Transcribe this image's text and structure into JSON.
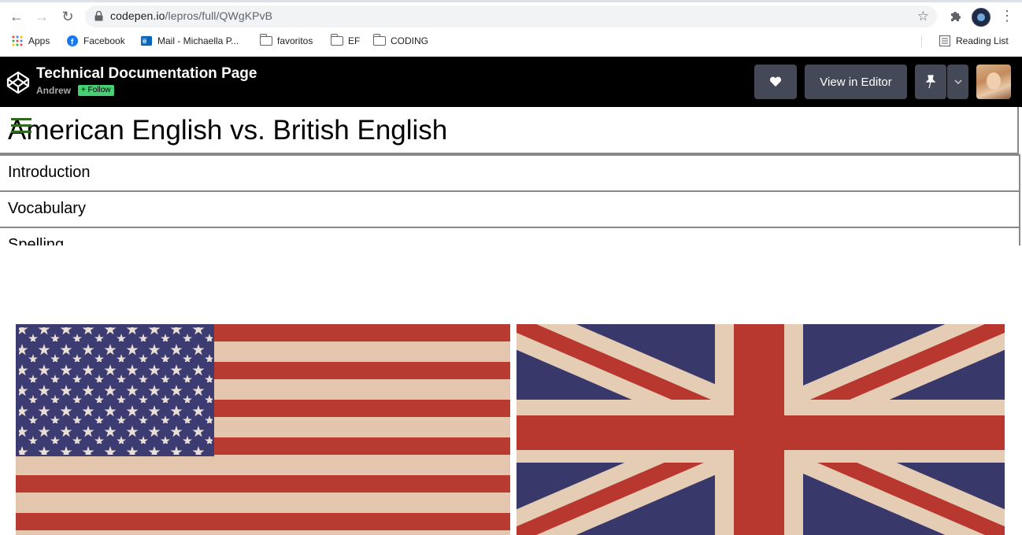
{
  "browser": {
    "url_host": "codepen.io",
    "url_path": "/lepros/full/QWgKPvB",
    "bookmarks": [
      {
        "label": "Apps",
        "icon": "apps-grid-icon"
      },
      {
        "label": "Facebook",
        "icon": "facebook-icon"
      },
      {
        "label": "Mail - Michaella P...",
        "icon": "outlook-icon"
      },
      {
        "label": "favoritos",
        "icon": "folder-icon"
      },
      {
        "label": "EF",
        "icon": "folder-icon"
      },
      {
        "label": "CODING",
        "icon": "folder-icon"
      }
    ],
    "reading_list": "Reading List"
  },
  "codepen": {
    "title": "Technical Documentation Page",
    "author": "Andrew",
    "follow": "+ Follow",
    "view_in_editor": "View in Editor",
    "heart_icon": "heart-icon",
    "pin_icon": "pin-icon"
  },
  "page": {
    "title": "American English vs. British English",
    "nav_items": [
      "Introduction",
      "Vocabulary",
      "Spelling"
    ],
    "accent_color": "#2e6b1f"
  }
}
